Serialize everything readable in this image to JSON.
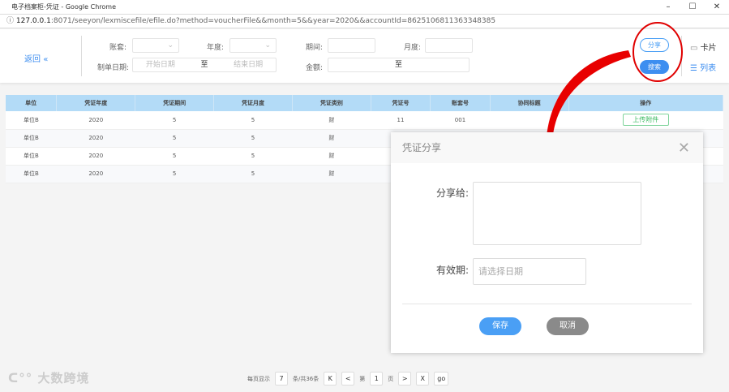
{
  "window": {
    "title": "电子档案柜-凭证 - Google Chrome",
    "minimize": "–",
    "maximize": "☐",
    "close": "✕"
  },
  "address": {
    "host": "127.0.0.1",
    "rest": ":8071/seeyon/lexmiscefile/efile.do?method=voucherFile&&month=5&&year=2020&&accountId=8625106811363348385"
  },
  "filters": {
    "back": "返回",
    "account_label": "账套:",
    "year_label": "年度:",
    "period_label": "期间:",
    "month_label": "月度:",
    "date_label": "制单日期:",
    "date_start_placeholder": "开始日期",
    "to": "至",
    "date_end_placeholder": "结束日期",
    "amount_label": "金额:",
    "share": "分享",
    "search": "搜索",
    "card_view": "卡片",
    "list_view": "列表"
  },
  "table": {
    "headers": [
      "单位",
      "凭证年度",
      "凭证期间",
      "凭证月度",
      "凭证类别",
      "凭证号",
      "账套号",
      "协同标题",
      "操作"
    ],
    "rows": [
      [
        "单位B",
        "2020",
        "5",
        "5",
        "财",
        "11",
        "001",
        "",
        "上传附件"
      ],
      [
        "单位B",
        "2020",
        "5",
        "5",
        "财",
        "",
        "",
        "",
        ""
      ],
      [
        "单位B",
        "2020",
        "5",
        "5",
        "财",
        "",
        "",
        "",
        ""
      ],
      [
        "单位B",
        "2020",
        "5",
        "5",
        "财",
        "",
        "",
        "",
        ""
      ]
    ]
  },
  "dialog": {
    "title": "凭证分享",
    "share_to_label": "分享给:",
    "expiry_label": "有效期:",
    "date_placeholder": "请选择日期",
    "save": "保存",
    "cancel": "取消"
  },
  "pager": {
    "per_page_label": "每页显示",
    "per_page": "7",
    "total": "条/共36条",
    "first": "K",
    "prev": "<",
    "page_label": "第",
    "page": "1",
    "page_unit": "页",
    "next": ">",
    "last": "X",
    "go": "go"
  },
  "watermark": "大数跨境",
  "colors": {
    "accent": "#3d8ef0",
    "header_bg": "#b3dbf7",
    "annotation": "#e00000"
  }
}
